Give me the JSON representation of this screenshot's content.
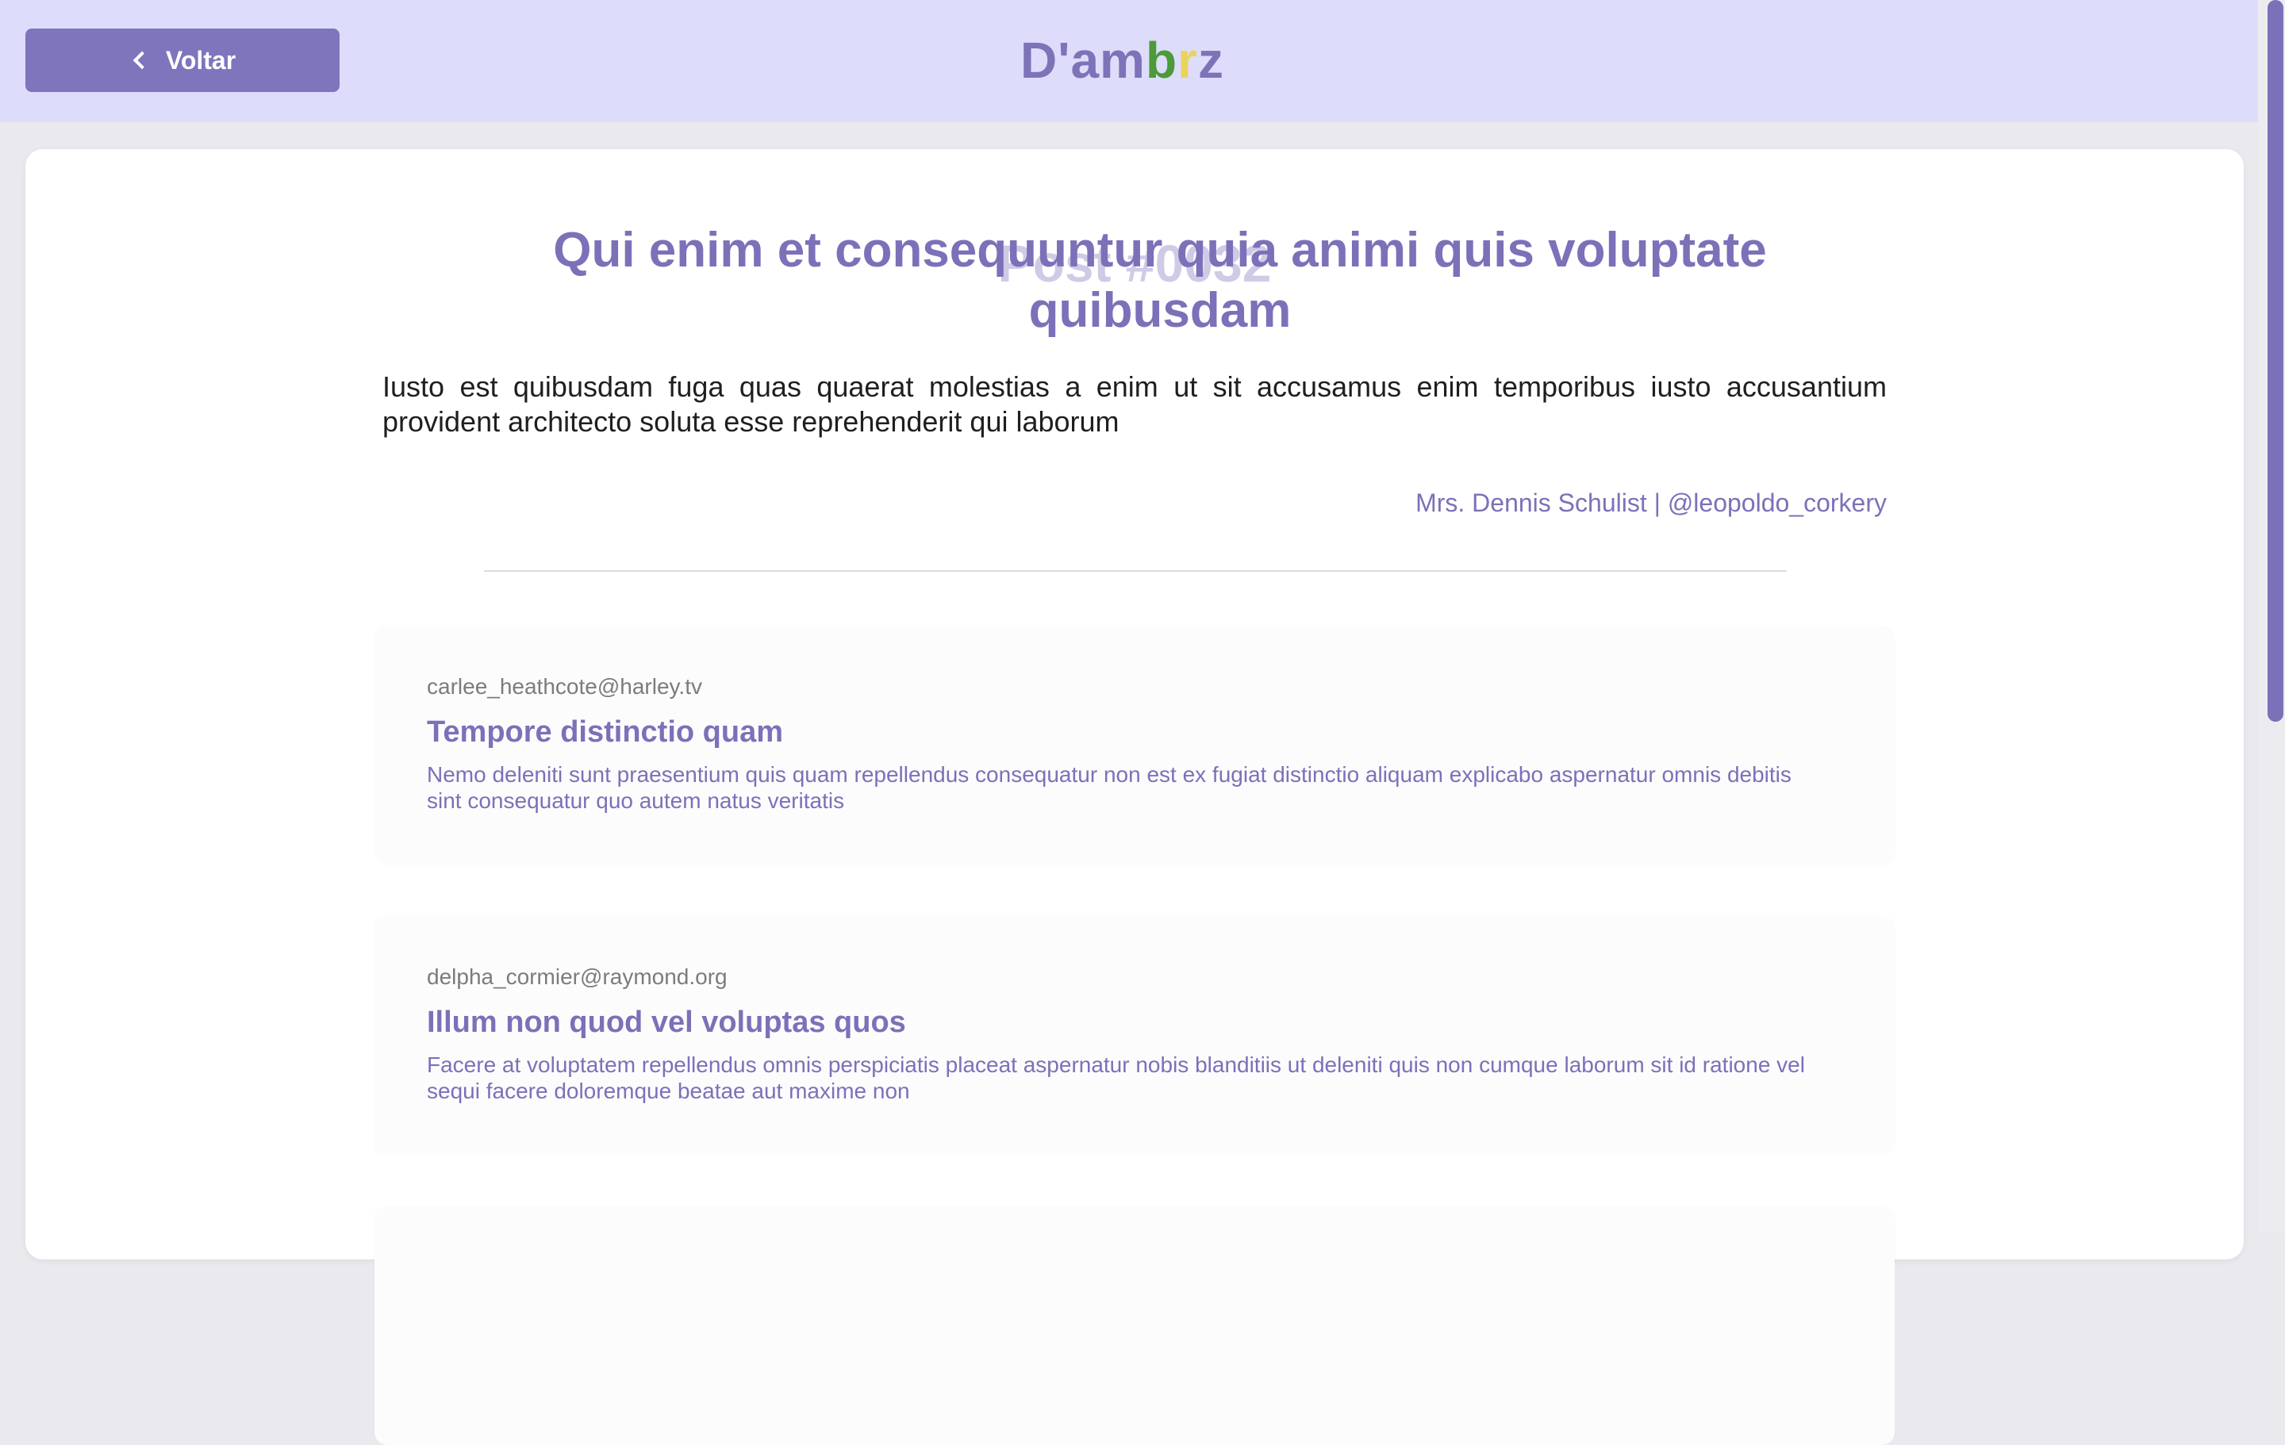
{
  "header": {
    "back_label": "Voltar",
    "logo": [
      {
        "text": "D'am",
        "color": "#7c73b8"
      },
      {
        "text": "b",
        "color": "#4c9a3a"
      },
      {
        "text": "r",
        "color": "#e8d45b"
      },
      {
        "text": "z",
        "color": "#7c73b8"
      }
    ]
  },
  "post": {
    "watermark": "Post #0032",
    "title": "Qui enim et consequuntur quia animi quis voluptate quibusdam",
    "body": "Iusto est quibusdam fuga quas quaerat molestias a enim ut sit accusamus enim temporibus iusto accusantium provident architecto soluta esse reprehenderit qui laborum",
    "author": "Mrs. Dennis Schulist | @leopoldo_corkery"
  },
  "comments": [
    {
      "email": "carlee_heathcote@harley.tv",
      "title": "Tempore distinctio quam",
      "body": "Nemo deleniti sunt praesentium quis quam repellendus consequatur non est ex fugiat distinctio aliquam explicabo aspernatur omnis debitis sint consequatur quo autem natus veritatis"
    },
    {
      "email": "delpha_cormier@raymond.org",
      "title": "Illum non quod vel voluptas quos",
      "body": "Facere at voluptatem repellendus omnis perspiciatis placeat aspernatur nobis blanditiis ut deleniti quis non cumque laborum sit id ratione vel sequi facere doloremque beatae aut maxime non"
    }
  ],
  "colors": {
    "accent": "#7b71b8",
    "header_bg": "#dedcfb",
    "page_bg": "#e9e9ee"
  }
}
